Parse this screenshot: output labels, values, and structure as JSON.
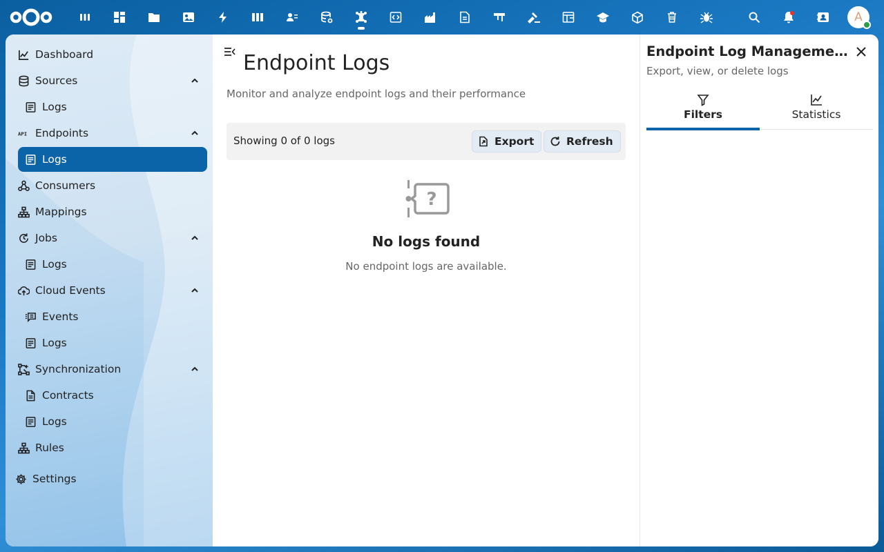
{
  "topbar": {
    "apps": [
      {
        "icon": "app-grid-icon"
      },
      {
        "icon": "dashboard-icon"
      },
      {
        "icon": "files-icon"
      },
      {
        "icon": "photos-icon"
      },
      {
        "icon": "activity-icon"
      },
      {
        "icon": "deck-icon"
      },
      {
        "icon": "contacts-icon"
      },
      {
        "icon": "database-icon"
      },
      {
        "icon": "openconnector-icon"
      },
      {
        "icon": "code-icon"
      },
      {
        "icon": "factory-icon"
      },
      {
        "icon": "document-icon"
      },
      {
        "icon": "flag-icon"
      },
      {
        "icon": "gavel-icon"
      },
      {
        "icon": "table-icon"
      },
      {
        "icon": "education-icon"
      },
      {
        "icon": "cube-icon"
      },
      {
        "icon": "trash-icon"
      },
      {
        "icon": "bug-icon"
      }
    ],
    "avatar_initial": "A"
  },
  "sidebar": {
    "items": [
      {
        "label": "Dashboard",
        "icon": "chart-icon"
      },
      {
        "label": "Sources",
        "icon": "database-icon"
      },
      {
        "label": "Logs",
        "icon": "log-icon"
      },
      {
        "label": "Endpoints",
        "icon": "api-icon"
      },
      {
        "label": "Logs",
        "icon": "log-icon"
      },
      {
        "label": "Consumers",
        "icon": "webhook-icon"
      },
      {
        "label": "Mappings",
        "icon": "sitemap-icon"
      },
      {
        "label": "Jobs",
        "icon": "update-icon"
      },
      {
        "label": "Logs",
        "icon": "log-icon"
      },
      {
        "label": "Cloud Events",
        "icon": "cloud-icon"
      },
      {
        "label": "Events",
        "icon": "message-icon"
      },
      {
        "label": "Logs",
        "icon": "log-icon"
      },
      {
        "label": "Synchronization",
        "icon": "sync-icon"
      },
      {
        "label": "Contracts",
        "icon": "contract-icon"
      },
      {
        "label": "Logs",
        "icon": "log-icon"
      },
      {
        "label": "Rules",
        "icon": "rules-icon"
      },
      {
        "label": "Settings",
        "icon": "gear-icon"
      }
    ]
  },
  "main": {
    "title": "Endpoint Logs",
    "subtitle": "Monitor and analyze endpoint logs and their performance",
    "count_text": "Showing 0 of 0 logs",
    "export_label": "Export",
    "refresh_label": "Refresh",
    "empty_title": "No logs found",
    "empty_subtitle": "No endpoint logs are available."
  },
  "right_panel": {
    "title": "Endpoint Log Management",
    "subtitle": "Export, view, or delete logs",
    "tabs": [
      {
        "label": "Filters"
      },
      {
        "label": "Statistics"
      }
    ]
  },
  "colors": {
    "accent": "#0b63a8",
    "topbar": "#0b5fa3"
  }
}
